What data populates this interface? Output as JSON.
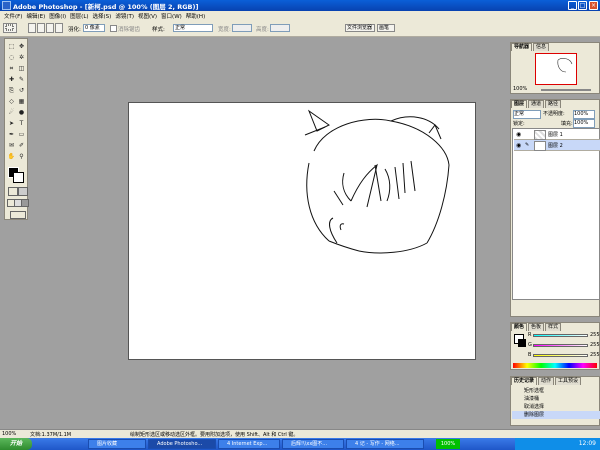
{
  "title_bar": {
    "title": "Adobe Photoshop - [新柯.psd @ 100% (图层 2, RGB)]",
    "min": "_",
    "max": "□",
    "close": "×"
  },
  "menu": [
    "文件(F)",
    "编辑(E)",
    "图像(I)",
    "图层(L)",
    "选择(S)",
    "滤镜(T)",
    "视图(V)",
    "窗口(W)",
    "帮助(H)"
  ],
  "options": {
    "feather_label": "羽化:",
    "feather_value": "0 像素",
    "antialias_label": "消除锯齿",
    "style_label": "样式:",
    "style_value": "正常",
    "width_label": "宽度:",
    "height_label": "高度:",
    "palette_well": [
      "文件浏览器",
      "画笔"
    ]
  },
  "toolbox_icons": [
    "marquee-tool-icon",
    "move-tool-icon",
    "lasso-tool-icon",
    "magic-wand-icon",
    "crop-tool-icon",
    "slice-tool-icon",
    "healing-brush-icon",
    "brush-tool-icon",
    "clone-stamp-icon",
    "history-brush-icon",
    "eraser-tool-icon",
    "gradient-tool-icon",
    "blur-tool-icon",
    "dodge-tool-icon",
    "path-select-icon",
    "type-tool-icon",
    "pen-tool-icon",
    "shape-tool-icon",
    "notes-tool-icon",
    "eyedropper-icon",
    "hand-tool-icon",
    "zoom-tool-icon"
  ],
  "navigator": {
    "tabs": [
      "导航器",
      "信息"
    ],
    "zoom": "100%"
  },
  "layers": {
    "tabs": [
      "图层",
      "通道",
      "路径"
    ],
    "blend_mode": "正常",
    "opacity_label": "不透明度:",
    "opacity_value": "100%",
    "lock_label": "锁定:",
    "fill_label": "填充:",
    "fill_value": "100%",
    "items": [
      {
        "name": "图层 1"
      },
      {
        "name": "图层 2"
      }
    ]
  },
  "color": {
    "tabs": [
      "颜色",
      "色板",
      "样式"
    ],
    "channels": [
      {
        "label": "R",
        "value": "255"
      },
      {
        "label": "G",
        "value": "255"
      },
      {
        "label": "B",
        "value": "255"
      }
    ]
  },
  "history": {
    "tabs": [
      "历史记录",
      "动作",
      "工具预设"
    ],
    "items": [
      "矩形选框",
      "油漆桶",
      "取消选择",
      "删除图层"
    ]
  },
  "status": {
    "zoom": "100%",
    "doc": "文档:1.37M/1.1M",
    "hint": "绘制矩形选区或移动选区外框。要用附加选项，使用 Shift、Alt 和 Ctrl 键。"
  },
  "taskbar": {
    "start": "开始",
    "tasks": [
      "图片收藏",
      "Adobe Photosho...",
      "4 Internet Exp...",
      "后辉!\\\\xx图不...",
      "4 记 - 写作 - 网络..."
    ],
    "ime": "100%",
    "clock": "12:09"
  },
  "colors": {
    "accent": "#0a5fd8",
    "panel": "#ece9d8",
    "workspace": "#a0a0a0"
  }
}
